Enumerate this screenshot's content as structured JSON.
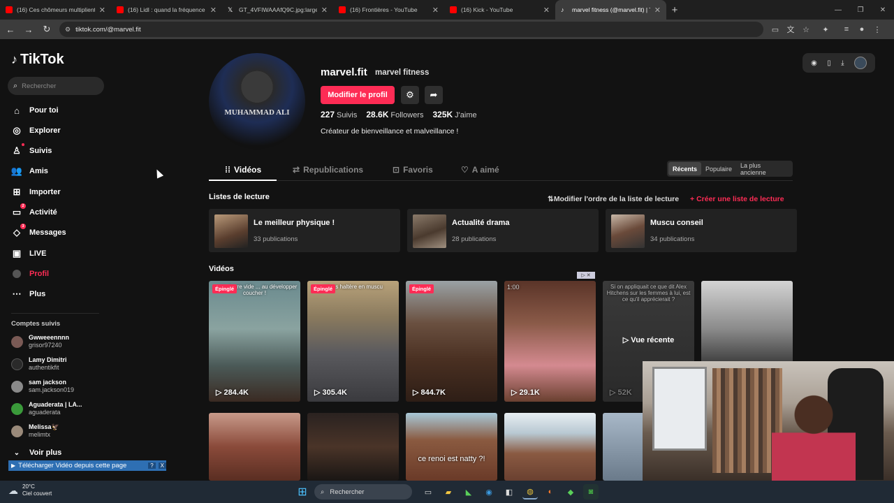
{
  "browser": {
    "tabs": [
      {
        "title": "(16) Ces chômeurs multiplient l",
        "favicon": "youtube-icon",
        "color": "#ff0000"
      },
      {
        "title": "(16) Lidl : quand la fréquence d",
        "favicon": "youtube-icon",
        "color": "#ff0000"
      },
      {
        "title": "GT_4VFIWAAAfQ9C.jpg:large (8",
        "favicon": "x-icon",
        "color": "#000000"
      },
      {
        "title": "(16) Frontières - YouTube",
        "favicon": "youtube-icon",
        "color": "#ff0000"
      },
      {
        "title": "(16) Kick - YouTube",
        "favicon": "youtube-icon",
        "color": "#ff0000"
      },
      {
        "title": "marvel fitness (@marvel.fit) | Ti",
        "favicon": "tiktok-icon",
        "color": "#000000",
        "active": true
      }
    ],
    "url": "tiktok.com/@marvel.fit"
  },
  "sidebar": {
    "logo": "TikTok",
    "search_placeholder": "Rechercher",
    "items": [
      {
        "label": "Pour toi",
        "icon": "home-icon"
      },
      {
        "label": "Explorer",
        "icon": "compass-icon"
      },
      {
        "label": "Suivis",
        "icon": "following-icon"
      },
      {
        "label": "Amis",
        "icon": "friends-icon"
      },
      {
        "label": "Importer",
        "icon": "upload-icon"
      },
      {
        "label": "Activité",
        "icon": "activity-icon",
        "badge": "2"
      },
      {
        "label": "Messages",
        "icon": "messages-icon",
        "badge": "3"
      },
      {
        "label": "LIVE",
        "icon": "live-icon"
      },
      {
        "label": "Profil",
        "icon": "profile-icon",
        "active": true
      },
      {
        "label": "Plus",
        "icon": "more-icon"
      }
    ],
    "following_heading": "Comptes suivis",
    "following": [
      {
        "name": "Gwweeennnn",
        "user": "grisor97240"
      },
      {
        "name": "Lamy Dimitri",
        "user": "authentikfit"
      },
      {
        "name": "sam jackson",
        "user": "sam.jackson019"
      },
      {
        "name": "Aguaderata | LA...",
        "user": "aguaderata"
      },
      {
        "name": "Melissa🦅",
        "user": "melimtx"
      }
    ],
    "see_more": "Voir plus",
    "download_bar": "Télécharger Vidéo depuis cette page",
    "download_buttons": [
      "?",
      "X"
    ]
  },
  "profile": {
    "avatar_text": "MUHAMMAD ALI",
    "username": "marvel.fit",
    "display_name": "marvel fitness",
    "edit_button": "Modifier le profil",
    "stats": [
      {
        "value": "227",
        "label": "Suivis"
      },
      {
        "value": "28.6K",
        "label": "Followers"
      },
      {
        "value": "325K",
        "label": "J'aime"
      }
    ],
    "bio": "Créateur de bienveillance et malveillance !"
  },
  "tabs": [
    {
      "label": "Vidéos",
      "active": true
    },
    {
      "label": "Republications"
    },
    {
      "label": "Favoris"
    },
    {
      "label": "A aimé"
    }
  ],
  "sort": [
    "Récents",
    "Populaire",
    "La plus ancienne"
  ],
  "playlists": {
    "heading": "Listes de lecture",
    "reorder": "Modifier l'ordre de la liste de lecture",
    "create": "Créer une liste de lecture",
    "items": [
      {
        "title": "Le meilleur physique !",
        "count": "33 publications"
      },
      {
        "title": "Actualité drama",
        "count": "28 publications"
      },
      {
        "title": "Muscu conseil",
        "count": "34 publications"
      }
    ]
  },
  "videos": {
    "heading": "Vidéos",
    "pinned_label": "Épinglé",
    "recent_label": "Vue récente",
    "items": [
      {
        "views": "284.4K",
        "pinned": true,
        "caption": "... une barre vide ... au développer coucher !"
      },
      {
        "views": "305.4K",
        "pinned": true,
        "caption": "prises haltère en muscu"
      },
      {
        "views": "844.7K",
        "pinned": true,
        "caption": ""
      },
      {
        "views": "29.1K",
        "caption": "1:00"
      },
      {
        "views": "52K",
        "caption": "Si on appliquait ce que dit Alex Hitchens sur les femmes à lui, est ce qu'il apprécierait ?"
      },
      {
        "views": "",
        "caption": ""
      },
      {
        "views": "",
        "caption": ""
      },
      {
        "views": "",
        "caption": ""
      },
      {
        "views": "",
        "caption": "ce renoi est natty ?!"
      },
      {
        "views": "",
        "caption": ""
      },
      {
        "views": "",
        "caption": ""
      }
    ]
  },
  "taskbar": {
    "weather_temp": "20°C",
    "weather_desc": "Ciel couvert",
    "search": "Rechercher"
  }
}
